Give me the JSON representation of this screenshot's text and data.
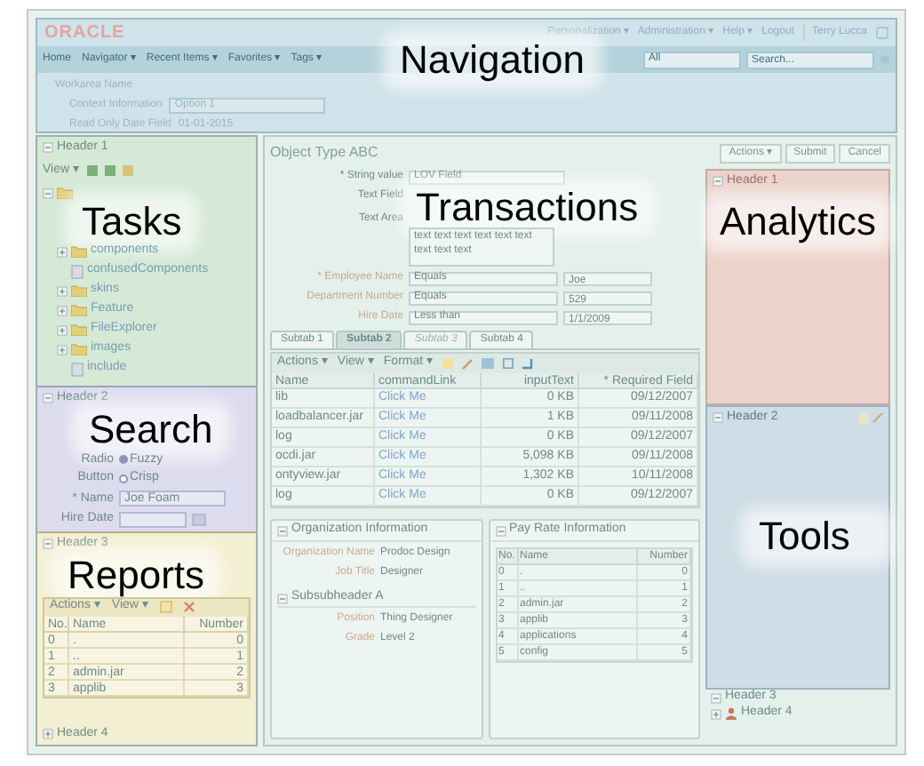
{
  "navigation": {
    "label": "Navigation",
    "logo": "ORACLE",
    "global_links": [
      "Personalization ▾",
      "Administration ▾",
      "Help ▾",
      "Logout"
    ],
    "user": "Terry Lucca",
    "menu": [
      "Home",
      "Navigator ▾",
      "Recent Items ▾",
      "Favorites ▾",
      "Tags ▾"
    ],
    "search_scope": "All",
    "search_placeholder": "Search...",
    "workarea": "Workarea Name",
    "context_label": "Context Information",
    "context_value": "Option 1",
    "date_label": "Read Only Date Field",
    "date_value": "01-01-2015"
  },
  "tasks": {
    "header": "Header 1",
    "label": "Tasks",
    "view_menu": "View ▾",
    "tree": [
      {
        "kind": "folder",
        "expanded": true,
        "children": [
          {
            "label": "components",
            "kind": "folder",
            "expanded": false
          },
          {
            "label": "confusedComponents",
            "kind": "file"
          },
          {
            "label": "skins",
            "kind": "folder",
            "expanded": false
          },
          {
            "label": "Feature",
            "kind": "folder",
            "expanded": false
          },
          {
            "label": "FileExplorer",
            "kind": "folder",
            "expanded": false
          },
          {
            "label": "images",
            "kind": "folder",
            "expanded": false
          },
          {
            "label": "include",
            "kind": "file"
          }
        ]
      }
    ]
  },
  "search": {
    "header": "Header 2",
    "label": "Search",
    "radio_label": "Radio Button",
    "radios": [
      {
        "label": "Fuzzy",
        "selected": true
      },
      {
        "label": "Crisp",
        "selected": false
      }
    ],
    "name_label": "* Name",
    "name_value": "Joe Foam",
    "date_label": "Hire Date"
  },
  "reports": {
    "header": "Header 3",
    "label": "Reports",
    "toolbar": [
      "Actions ▾",
      "View ▾"
    ],
    "columns": [
      "No.",
      "Name",
      "Number"
    ],
    "rows": [
      [
        "0",
        ".",
        "0"
      ],
      [
        "1",
        "..",
        "1"
      ],
      [
        "2",
        "admin.jar",
        "2"
      ],
      [
        "3",
        "applib",
        "3"
      ]
    ],
    "footer": "Header 4"
  },
  "object": {
    "title": "Object Type ABC",
    "buttons": [
      "Actions ▾",
      "Submit",
      "Cancel"
    ],
    "label": "Transactions",
    "string_label": "* String value",
    "string_value": "LOV Field",
    "text_field_label": "Text Field",
    "text_area_label": "Text Area",
    "text_area_value": "text text text text text text text text text",
    "criteria": [
      {
        "label": "* Employee Name",
        "operator": "Equals",
        "value": "Joe"
      },
      {
        "label": "Department Number",
        "operator": "Equals",
        "value": "529"
      },
      {
        "label": "Hire Date",
        "operator": "Less than",
        "value": "1/1/2009"
      }
    ],
    "subtabs": [
      {
        "label": "Subtab 1",
        "selected": false,
        "disabled": false
      },
      {
        "label": "Subtab 2",
        "selected": true,
        "disabled": false
      },
      {
        "label": "Subtab 3",
        "selected": false,
        "disabled": true
      },
      {
        "label": "Subtab 4",
        "selected": false,
        "disabled": false
      }
    ],
    "table_toolbar": [
      "Actions ▾",
      "View ▾",
      "Format ▾"
    ],
    "table": {
      "columns": [
        "Name",
        "commandLink",
        "inputText",
        "* Required Field"
      ],
      "rows": [
        [
          "lib",
          "Click Me",
          "0 KB",
          "09/12/2007"
        ],
        [
          "loadbalancer.jar",
          "Click Me",
          "1 KB",
          "09/11/2008"
        ],
        [
          "log",
          "Click Me",
          "0 KB",
          "09/12/2007"
        ],
        [
          "ocdi.jar",
          "Click Me",
          "5,098 KB",
          "09/11/2008"
        ],
        [
          "ontyview.jar",
          "Click Me",
          "1,302 KB",
          "10/11/2008"
        ],
        [
          "log",
          "Click Me",
          "0 KB",
          "09/12/2007"
        ]
      ]
    },
    "org": {
      "title": "Organization Information",
      "fields": [
        {
          "label": "Organization Name",
          "value": "Prodoc Design"
        },
        {
          "label": "Job Title",
          "value": "Designer"
        }
      ],
      "subheader": "Subsubheader A",
      "subfields": [
        {
          "label": "Position",
          "value": "Thing Designer"
        },
        {
          "label": "Grade",
          "value": "Level 2"
        }
      ]
    },
    "pay": {
      "title": "Pay Rate Information",
      "columns": [
        "No.",
        "Name",
        "Number"
      ],
      "rows": [
        [
          "0",
          ".",
          "0"
        ],
        [
          "1",
          "..",
          "1"
        ],
        [
          "2",
          "admin.jar",
          "2"
        ],
        [
          "3",
          "applib",
          "3"
        ],
        [
          "4",
          "applications",
          "4"
        ],
        [
          "5",
          "config",
          "5"
        ]
      ]
    }
  },
  "right": {
    "analytics_header": "Header 1",
    "analytics_label": "Analytics",
    "tools_header": "Header 2",
    "tools_label": "Tools",
    "footers": [
      "Header 3",
      "Header 4"
    ]
  }
}
